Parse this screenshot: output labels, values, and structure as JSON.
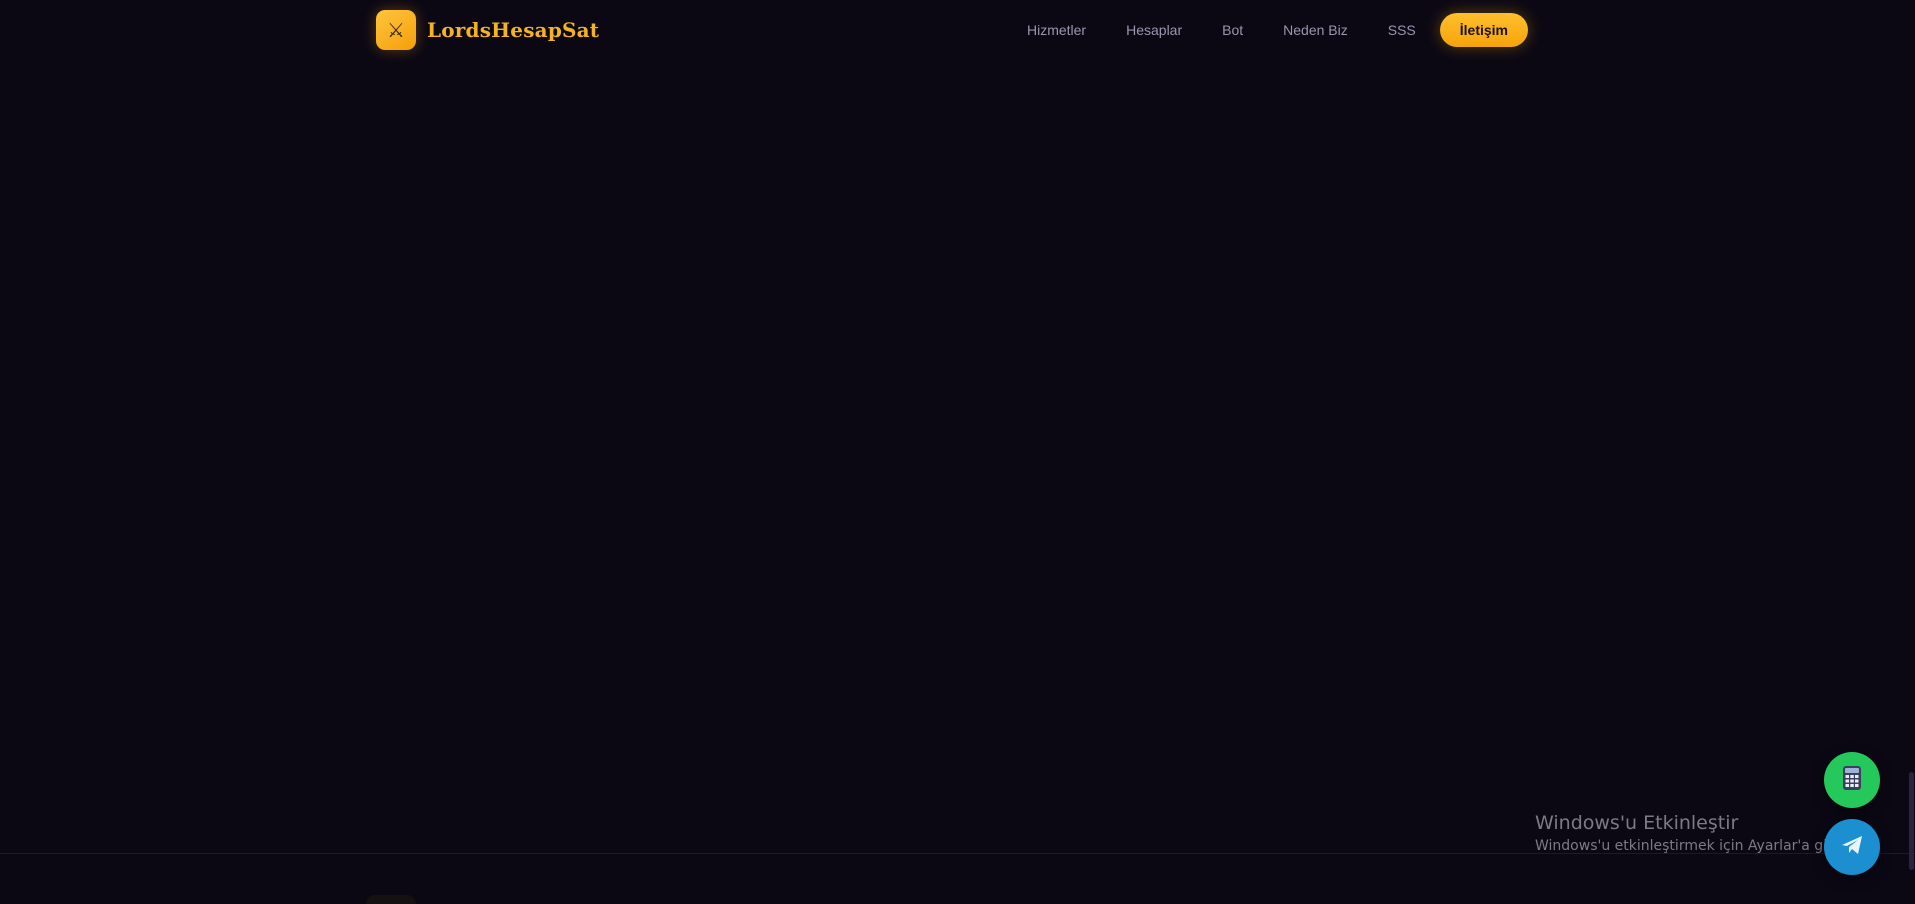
{
  "brand": {
    "name": "LordsHesapSat",
    "icon": "crossed-swords-icon",
    "accent": "#f5b324"
  },
  "nav": {
    "items": [
      {
        "label": "Hizmetler"
      },
      {
        "label": "Hesaplar"
      },
      {
        "label": "Bot"
      },
      {
        "label": "Neden Biz"
      },
      {
        "label": "SSS"
      }
    ],
    "cta_label": "İletişim"
  },
  "floating_buttons": [
    {
      "icon": "phone-icon",
      "color": "#25c85a"
    },
    {
      "icon": "telegram-icon",
      "color": "#1b8fd0"
    }
  ],
  "watermark": {
    "title": "Windows'u Etkinleştir",
    "subtitle": "Windows'u etkinleştirmek için Ayarlar'a gidin."
  },
  "colors": {
    "background": "#0b0814",
    "nav_text": "#9b95ad",
    "cta_bg": "#f5a40c"
  }
}
